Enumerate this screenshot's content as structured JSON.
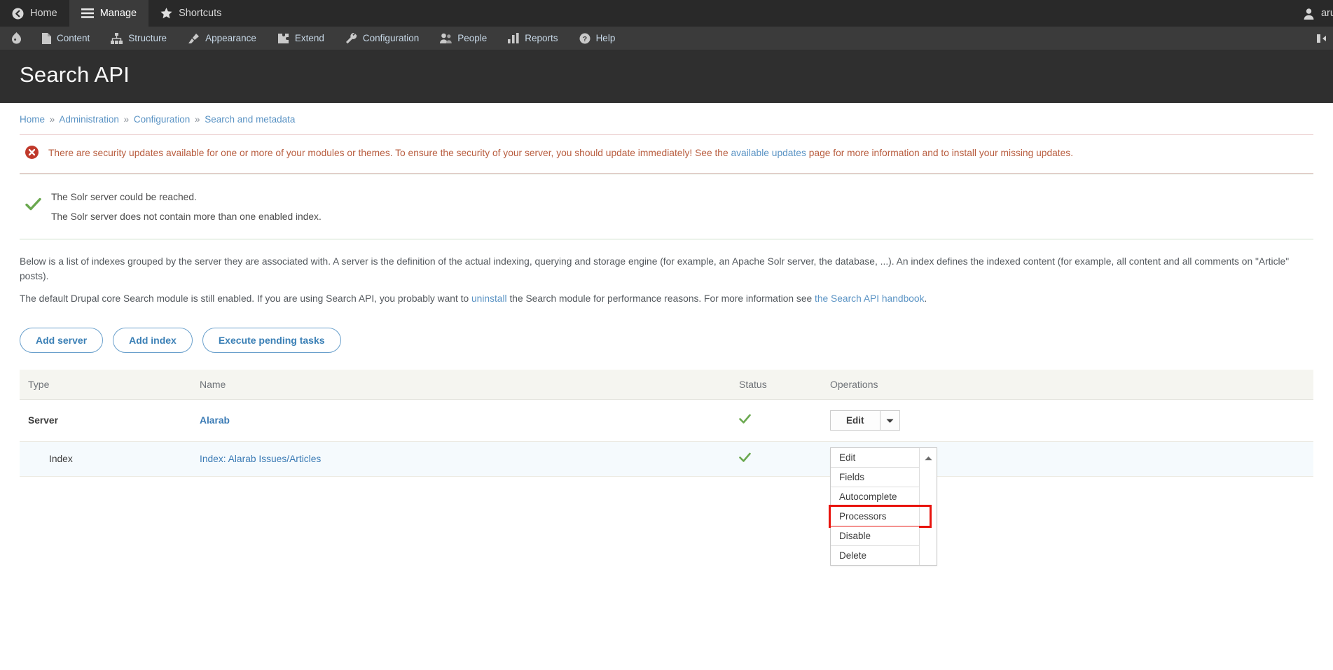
{
  "toolbar": {
    "home_label": "Home",
    "manage_label": "Manage",
    "shortcuts_label": "Shortcuts",
    "user_label": "arun"
  },
  "menu": {
    "items": [
      {
        "label": "Content",
        "icon": "document-icon"
      },
      {
        "label": "Structure",
        "icon": "structure-icon"
      },
      {
        "label": "Appearance",
        "icon": "paintbrush-icon"
      },
      {
        "label": "Extend",
        "icon": "puzzle-icon"
      },
      {
        "label": "Configuration",
        "icon": "wrench-icon"
      },
      {
        "label": "People",
        "icon": "people-icon"
      },
      {
        "label": "Reports",
        "icon": "bar-chart-icon"
      },
      {
        "label": "Help",
        "icon": "question-mark-icon"
      }
    ]
  },
  "page": {
    "title": "Search API"
  },
  "breadcrumb": {
    "items": [
      "Home",
      "Administration",
      "Configuration",
      "Search and metadata"
    ],
    "separator": "»"
  },
  "messages": {
    "error": {
      "text_before_link": "There are security updates available for one or more of your modules or themes. To ensure the security of your server, you should update immediately! See the ",
      "link_text": "available updates",
      "text_after_link": " page for more information and to install your missing updates.",
      "icon": "error-icon",
      "color": "#b85c3e"
    },
    "status": {
      "lines": [
        "The Solr server could be reached.",
        "The Solr server does not contain more than one enabled index."
      ],
      "icon": "check-icon",
      "color": "#6aa84f"
    }
  },
  "intro": {
    "paragraph1": "Below is a list of indexes grouped by the server they are associated with. A server is the definition of the actual indexing, querying and storage engine (for example, an Apache Solr server, the database, ...). An index defines the indexed content (for example, all content and all comments on \"Article\" posts).",
    "p2_before": "The default Drupal core Search module is still enabled. If you are using Search API, you probably want to ",
    "p2_link1": "uninstall",
    "p2_middle": " the Search module for performance reasons. For more information see ",
    "p2_link2": "the Search API handbook",
    "p2_after": "."
  },
  "actions": {
    "add_server": "Add server",
    "add_index": "Add index",
    "execute_pending_tasks": "Execute pending tasks"
  },
  "table": {
    "headers": [
      "Type",
      "Name",
      "Status",
      "Operations"
    ],
    "rows": [
      {
        "type": "Server",
        "name": "Alarab",
        "status_icon": "check-icon",
        "operation_label": "Edit"
      },
      {
        "type": "Index",
        "name": "Index: Alarab Issues/Articles",
        "status_icon": "check-icon",
        "operation_label": "Edit"
      }
    ]
  },
  "dropdown": {
    "open": true,
    "items": [
      "Edit",
      "Fields",
      "Autocomplete",
      "Processors",
      "Disable",
      "Delete"
    ],
    "highlighted_item": "Processors",
    "highlight_color": "#e8140e",
    "toggle_icon": "chevron-up-icon"
  }
}
